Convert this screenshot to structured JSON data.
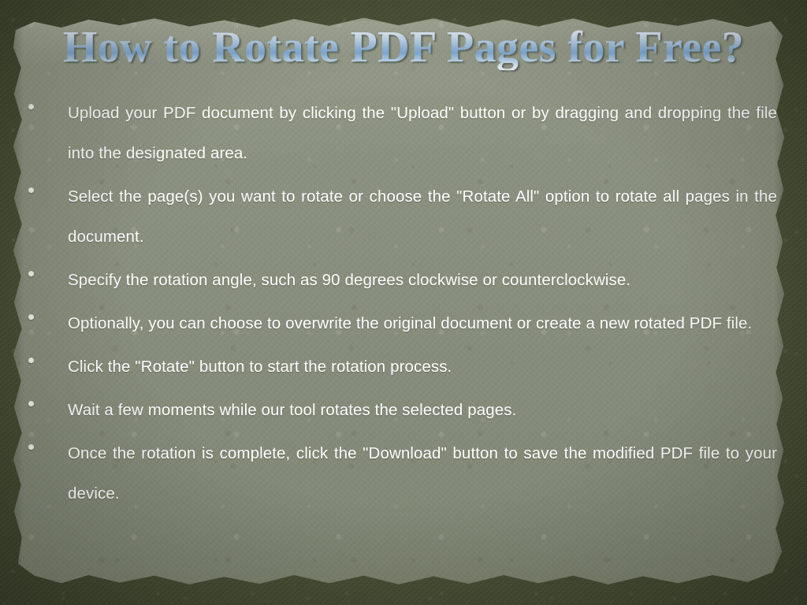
{
  "slide": {
    "title": "How to Rotate PDF Pages for Free?",
    "bullets": [
      {
        "text": "Upload your PDF document by clicking the \"Upload\" button or by dragging and dropping the file into the designated area.",
        "lines": 2
      },
      {
        "text": "Select the page(s) you want to rotate or choose the \"Rotate All\" option to rotate all pages in the document.",
        "lines": 2
      },
      {
        "text": "Specify the rotation angle, such as 90 degrees clockwise or counterclockwise.",
        "lines": 2
      },
      {
        "text": "Optionally, you can choose to overwrite the original document or create a new rotated PDF file.",
        "lines": 2
      },
      {
        "text": "Click the \"Rotate\" button to start the rotation process.",
        "lines": 1
      },
      {
        "text": "Wait a few moments while our tool rotates the selected pages.",
        "lines": 1
      },
      {
        "text": "Once the rotation is complete, click the \"Download\" button to save the modified PDF file to your device.",
        "lines": 2
      }
    ],
    "bullet_glyph": "•",
    "colors": {
      "backdrop_olive": "#4e5539",
      "paper_sage": "#8a9082",
      "body_text": "#ffffff",
      "title_light": "#f2f6fb",
      "title_blue": "#7ea8d0"
    }
  }
}
